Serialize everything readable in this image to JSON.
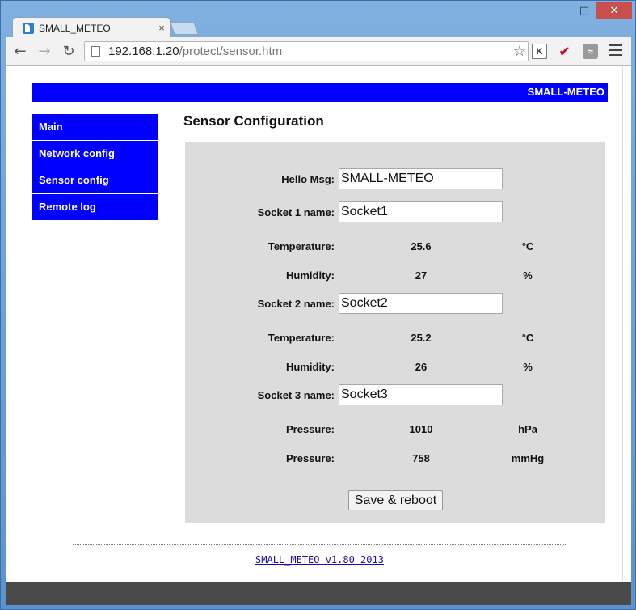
{
  "browser": {
    "tab_title": "SMALL_METEO",
    "tab_close": "×",
    "url_host": "192.168.1.20",
    "url_path": "/protect/sensor.htm",
    "window_minimize": "–",
    "window_maximize": "□",
    "window_close": "✕"
  },
  "header": {
    "brand": "SMALL-METEO"
  },
  "sidebar": {
    "items": [
      {
        "label": "Main"
      },
      {
        "label": "Network config"
      },
      {
        "label": "Sensor config"
      },
      {
        "label": "Remote log"
      }
    ]
  },
  "content": {
    "title": "Sensor Configuration",
    "hello_msg": {
      "label": "Hello Msg:",
      "value": "SMALL-METEO"
    },
    "socket1": {
      "label": "Socket 1 name:",
      "value": "Socket1",
      "temperature": {
        "label": "Temperature:",
        "value": "25.6",
        "unit": "°C"
      },
      "humidity": {
        "label": "Humidity:",
        "value": "27",
        "unit": "%"
      }
    },
    "socket2": {
      "label": "Socket 2 name:",
      "value": "Socket2",
      "temperature": {
        "label": "Temperature:",
        "value": "25.2",
        "unit": "°C"
      },
      "humidity": {
        "label": "Humidity:",
        "value": "26",
        "unit": "%"
      }
    },
    "socket3": {
      "label": "Socket 3 name:",
      "value": "Socket3",
      "pressure_hpa": {
        "label": "Pressure:",
        "value": "1010",
        "unit": "hPa"
      },
      "pressure_mmhg": {
        "label": "Pressure:",
        "value": "758",
        "unit": "mmHg"
      }
    },
    "save_label": "Save & reboot"
  },
  "footer": {
    "link_text": "SMALL_METEO v1.80 2013"
  },
  "colors": {
    "nav_blue": "#0000ff",
    "panel_grey": "#dcdcdc"
  }
}
